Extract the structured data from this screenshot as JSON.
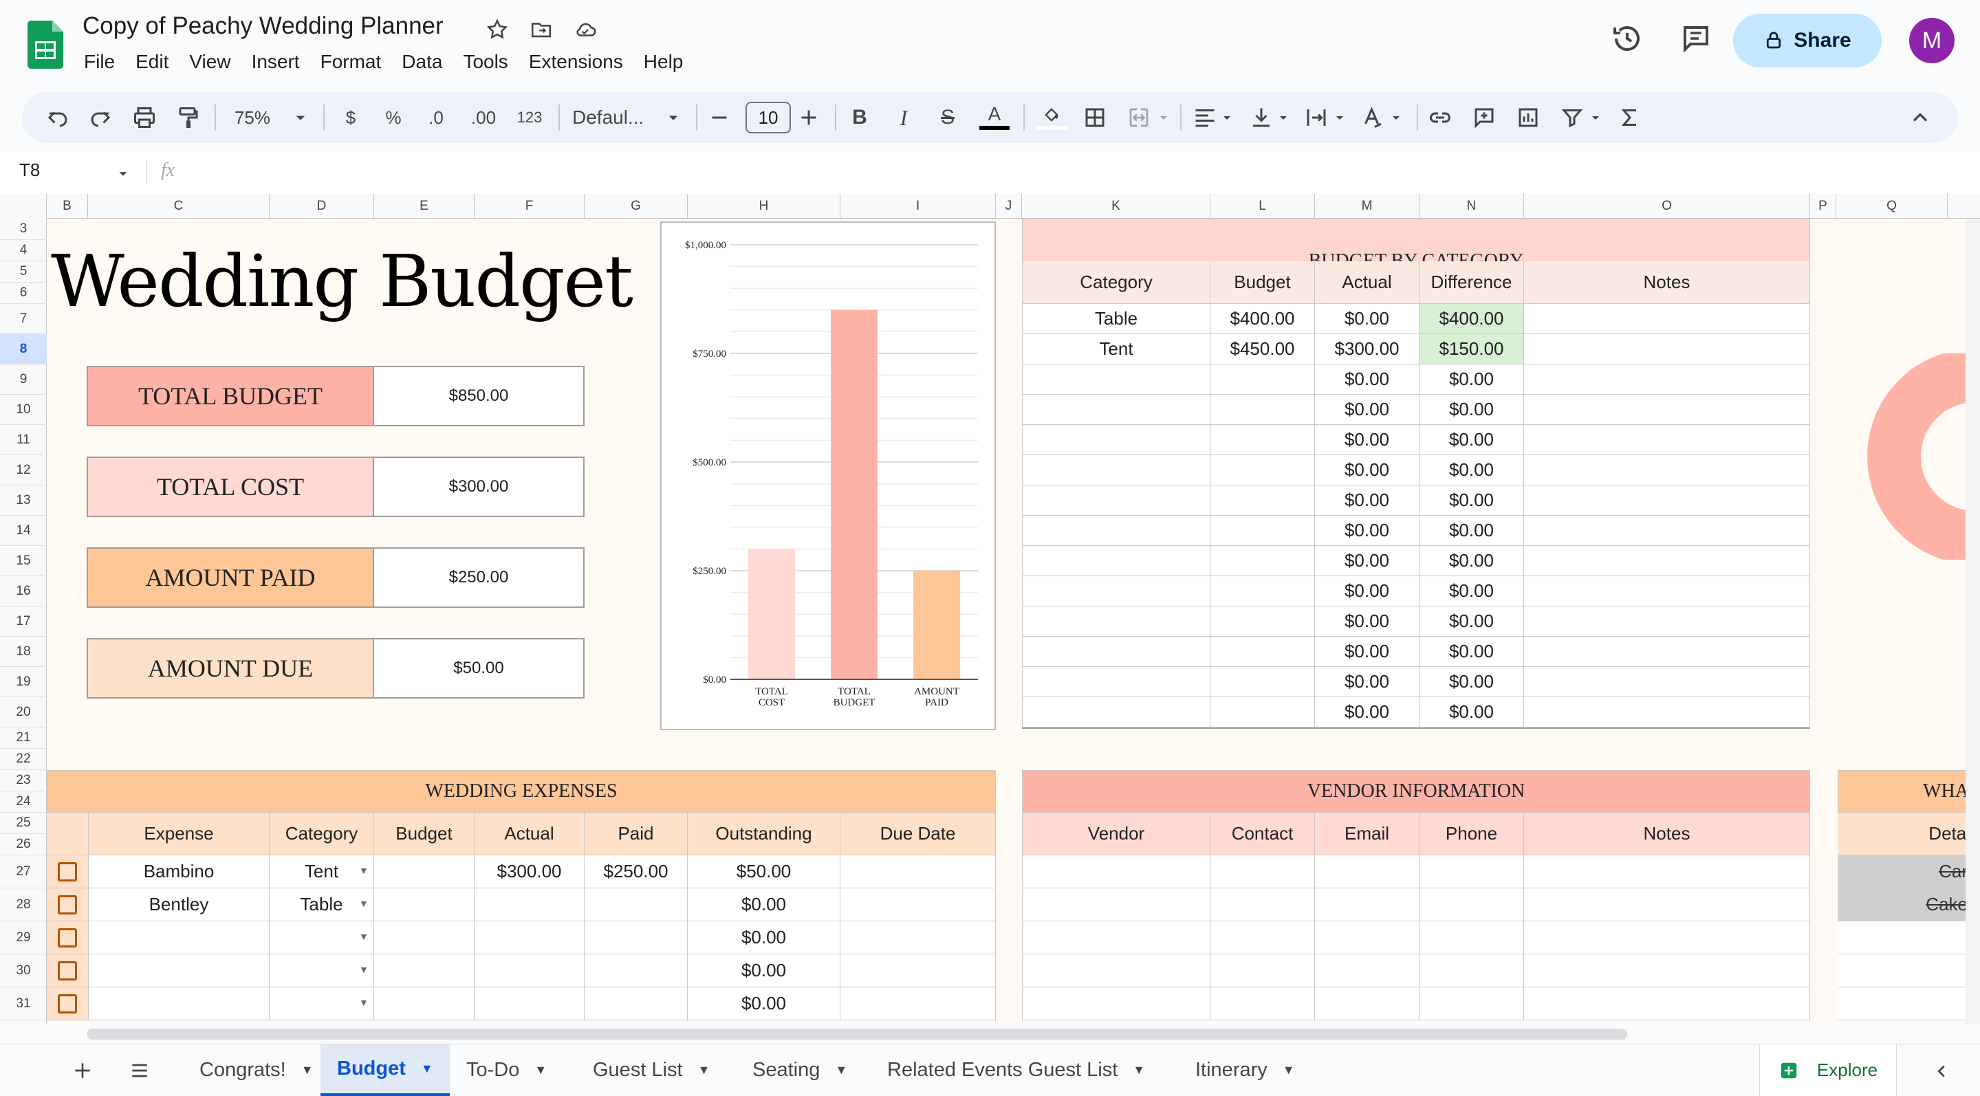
{
  "app": {
    "title": "Copy of Peachy Wedding Planner",
    "share_label": "Share",
    "avatar_letter": "M"
  },
  "menu": [
    "File",
    "Edit",
    "View",
    "Insert",
    "Format",
    "Data",
    "Tools",
    "Extensions",
    "Help"
  ],
  "toolbar": {
    "zoom": "75%",
    "currency": "$",
    "percent": "%",
    "dec_less": ".0",
    "dec_more": ".00",
    "number_format": "123",
    "font": "Defaul...",
    "font_size": "10"
  },
  "formula_bar": {
    "cell_ref": "T8",
    "fx": "fx",
    "value": ""
  },
  "columns": [
    "B",
    "C",
    "D",
    "E",
    "F",
    "G",
    "H",
    "I",
    "J",
    "K",
    "L",
    "M",
    "N",
    "O",
    "P",
    "Q"
  ],
  "rows": [
    "3",
    "4",
    "5",
    "6",
    "7",
    "8",
    "9",
    "10",
    "11",
    "12",
    "13",
    "14",
    "15",
    "16",
    "17",
    "18",
    "19",
    "20",
    "21",
    "22",
    "23",
    "24",
    "25",
    "26",
    "27",
    "28",
    "29",
    "30",
    "31"
  ],
  "budget": {
    "title": "Wedding Budget",
    "stats": [
      {
        "label": "TOTAL BUDGET",
        "value": "$850.00",
        "color": "#ffb3a7"
      },
      {
        "label": "TOTAL COST",
        "value": "$300.00",
        "color": "#ffd9d2"
      },
      {
        "label": "AMOUNT PAID",
        "value": "$250.00",
        "color": "#ffc697"
      },
      {
        "label": "AMOUNT DUE",
        "value": "$50.00",
        "color": "#ffe1c9"
      }
    ]
  },
  "chart_data": {
    "type": "bar",
    "categories": [
      "TOTAL COST",
      "TOTAL BUDGET",
      "AMOUNT PAID"
    ],
    "category_lines": [
      [
        "TOTAL",
        "COST"
      ],
      [
        "TOTAL",
        "BUDGET"
      ],
      [
        "AMOUNT",
        "PAID"
      ]
    ],
    "values": [
      300,
      850,
      250
    ],
    "colors": [
      "#ffd9d2",
      "#ffb3a7",
      "#ffc697"
    ],
    "ylim": [
      0,
      1000
    ],
    "yticks": [
      0,
      250,
      500,
      750,
      1000
    ],
    "ytick_labels": [
      "$0.00",
      "$250.00",
      "$500.00",
      "$750.00",
      "$1,000.00"
    ],
    "grid": true
  },
  "budget_by_category": {
    "title": "BUDGET BY CATEGORY",
    "headers": [
      "Category",
      "Budget",
      "Actual",
      "Difference",
      "Notes"
    ],
    "rows": [
      [
        "Table",
        "$400.00",
        "$0.00",
        "$400.00",
        ""
      ],
      [
        "Tent",
        "$450.00",
        "$300.00",
        "$150.00",
        ""
      ],
      [
        "",
        "",
        "$0.00",
        "$0.00",
        ""
      ],
      [
        "",
        "",
        "$0.00",
        "$0.00",
        ""
      ],
      [
        "",
        "",
        "$0.00",
        "$0.00",
        ""
      ],
      [
        "",
        "",
        "$0.00",
        "$0.00",
        ""
      ],
      [
        "",
        "",
        "$0.00",
        "$0.00",
        ""
      ],
      [
        "",
        "",
        "$0.00",
        "$0.00",
        ""
      ],
      [
        "",
        "",
        "$0.00",
        "$0.00",
        ""
      ],
      [
        "",
        "",
        "$0.00",
        "$0.00",
        ""
      ],
      [
        "",
        "",
        "$0.00",
        "$0.00",
        ""
      ],
      [
        "",
        "",
        "$0.00",
        "$0.00",
        ""
      ],
      [
        "",
        "",
        "$0.00",
        "$0.00",
        ""
      ],
      [
        "",
        "",
        "$0.00",
        "$0.00",
        ""
      ]
    ]
  },
  "wedding_expenses": {
    "title": "WEDDING EXPENSES",
    "headers": [
      "Expense",
      "Category",
      "Budget",
      "Actual",
      "Paid",
      "Outstanding",
      "Due Date"
    ],
    "rows": [
      [
        "Bambino",
        "Tent",
        "",
        "$300.00",
        "$250.00",
        "$50.00",
        ""
      ],
      [
        "Bentley",
        "Table",
        "",
        "",
        "",
        "$0.00",
        ""
      ],
      [
        "",
        "",
        "",
        "",
        "",
        "$0.00",
        ""
      ],
      [
        "",
        "",
        "",
        "",
        "",
        "$0.00",
        ""
      ],
      [
        "",
        "",
        "",
        "",
        "",
        "$0.00",
        ""
      ]
    ]
  },
  "vendor_info": {
    "title": "VENDOR INFORMATION",
    "headers": [
      "Vendor",
      "Contact",
      "Email",
      "Phone",
      "Notes"
    ]
  },
  "what_section": {
    "title": "WHA",
    "header": "Detai",
    "items": [
      "Car",
      "Cake"
    ]
  },
  "tabs": [
    "Congrats!",
    "Budget",
    "To-Do",
    "Guest List",
    "Seating",
    "Related Events Guest List",
    "Itinerary"
  ],
  "active_tab": "Budget",
  "explore_label": "Explore"
}
